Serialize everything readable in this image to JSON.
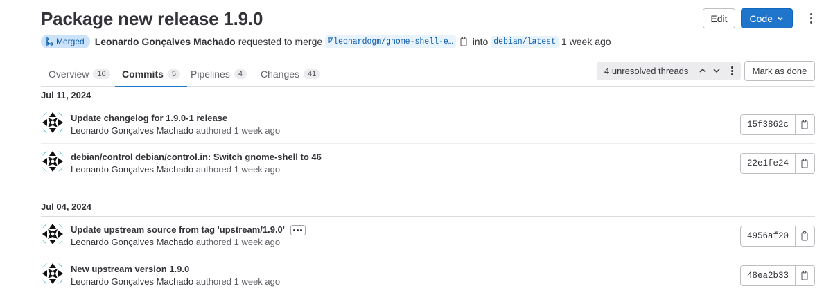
{
  "mr": {
    "title": "Package new release 1.9.0",
    "status": "Merged",
    "author": "Leonardo Gonçalves Machado",
    "requested_text": "requested to merge",
    "source_branch": "leonardogm/gnome-shell-e…",
    "into_text": "into",
    "target_branch": "debian/latest",
    "time_ago": "1 week ago"
  },
  "header_actions": {
    "edit_label": "Edit",
    "code_label": "Code"
  },
  "tabs": [
    {
      "label": "Overview",
      "count": "16"
    },
    {
      "label": "Commits",
      "count": "5"
    },
    {
      "label": "Pipelines",
      "count": "4"
    },
    {
      "label": "Changes",
      "count": "41"
    }
  ],
  "threads": {
    "label": "4 unresolved threads",
    "mark_done_label": "Mark as done"
  },
  "commit_groups": [
    {
      "date": "Jul 11, 2024",
      "commits": [
        {
          "title": "Update changelog for 1.9.0-1 release",
          "author": "Leonardo Gonçalves Machado",
          "authored": "authored 1 week ago",
          "sha": "15f3862c"
        },
        {
          "title": "debian/control debian/control.in: Switch gnome-shell to 46",
          "author": "Leonardo Gonçalves Machado",
          "authored": "authored 1 week ago",
          "sha": "22e1fe24"
        }
      ]
    },
    {
      "date": "Jul 04, 2024",
      "commits": [
        {
          "title": "Update upstream source from tag 'upstream/1.9.0'",
          "author": "Leonardo Gonçalves Machado",
          "authored": "authored 1 week ago",
          "sha": "4956af20"
        },
        {
          "title": "New upstream version 1.9.0",
          "author": "Leonardo Gonçalves Machado",
          "authored": "authored 1 week ago",
          "sha": "48ea2b33"
        }
      ]
    }
  ],
  "colors": {
    "accent": "#1f75cb",
    "merged_bg": "#cbe2f9",
    "merged_text": "#0b5cad"
  },
  "icons": [
    "merge-icon",
    "branch-icon",
    "copy-icon",
    "chevron-down-icon",
    "chevron-up-icon",
    "kebab-icon"
  ]
}
